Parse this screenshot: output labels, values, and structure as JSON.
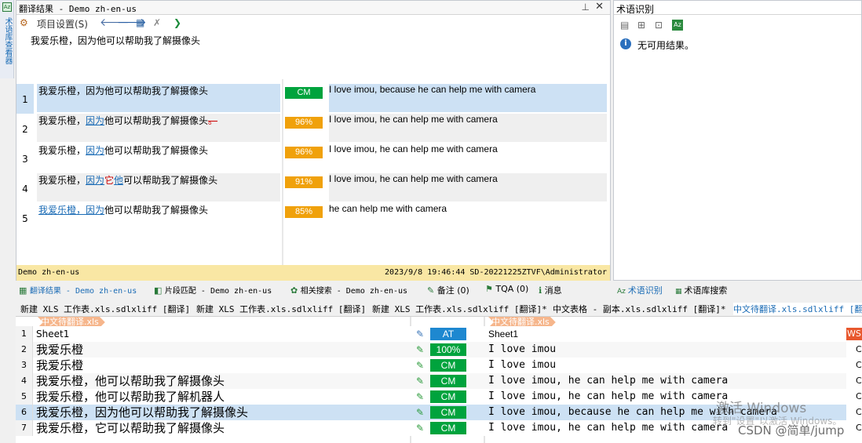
{
  "left_vertical_tab": {
    "label": "术语库查看器"
  },
  "translation_results": {
    "title": "翻译结果 - Demo zh-en-us",
    "toolbar": {
      "project_settings": "项目设置(S)"
    },
    "source_text": "我爱乐橙，因为他可以帮助我了解摄像头",
    "rows": [
      {
        "num": "1",
        "source": [
          {
            "t": "我爱乐橙，因为他可以帮助我了解摄像头",
            "s": ""
          }
        ],
        "badge": "CM",
        "badge_color": "#00a33d",
        "target": "I love imou, because he can help me with camera",
        "selected": true
      },
      {
        "num": "2",
        "source": [
          {
            "t": "我爱乐橙，",
            "s": ""
          },
          {
            "t": "因为",
            "s": "u"
          },
          {
            "t": "他可以帮助我了解摄像头",
            "s": ""
          },
          {
            "t": "。",
            "s": "x"
          }
        ],
        "badge": "96%",
        "badge_color": "#f0a10b",
        "target": "I love imou, he can help me with camera",
        "selected": false
      },
      {
        "num": "3",
        "source": [
          {
            "t": "我爱乐橙，",
            "s": ""
          },
          {
            "t": "因为",
            "s": "u"
          },
          {
            "t": "他可以帮助我了解摄像头",
            "s": ""
          }
        ],
        "badge": "96%",
        "badge_color": "#f0a10b",
        "target": "I love imou, he can help me with camera",
        "selected": false
      },
      {
        "num": "4",
        "source": [
          {
            "t": "我爱乐橙，",
            "s": ""
          },
          {
            "t": "因为",
            "s": "u"
          },
          {
            "t": "它",
            "s": "r"
          },
          {
            "t": "他",
            "s": "u"
          },
          {
            "t": "可以帮助我了解摄像头",
            "s": ""
          }
        ],
        "badge": "91%",
        "badge_color": "#f0a10b",
        "target": "I love imou, he can help me with camera",
        "selected": false
      },
      {
        "num": "5",
        "source": [
          {
            "t": "我爱乐橙，因为",
            "s": "u"
          },
          {
            "t": "他可以帮助我了解摄像头",
            "s": ""
          }
        ],
        "badge": "85%",
        "badge_color": "#f0a10b",
        "target": "he can help me with camera",
        "selected": false
      }
    ],
    "status": {
      "left": "Demo zh-en-us",
      "right": "2023/9/8 19:46:44 SD-20221225ZTVF\\Administrator"
    }
  },
  "term_recognition": {
    "title": "术语识别",
    "message": "无可用结果。"
  },
  "bottom_tabs": [
    {
      "label": "翻译结果 - Demo zh-en-us",
      "active": true
    },
    {
      "label": "片段匹配 - Demo zh-en-us",
      "active": false
    },
    {
      "label": "相关搜索 - Demo zh-en-us",
      "active": false
    },
    {
      "label": "备注 (0)",
      "active": false
    },
    {
      "label": "TQA (0)",
      "active": false
    },
    {
      "label": "消息",
      "active": false
    }
  ],
  "right_bottom_tabs": [
    {
      "label": "术语识别",
      "active": true
    },
    {
      "label": "术语库搜索",
      "active": false
    }
  ],
  "doc_tabs": [
    {
      "label": "新建 XLS 工作表.xls.sdlxliff [翻译]"
    },
    {
      "label": "新建 XLS 工作表.xls.sdlxliff [翻译]"
    },
    {
      "label": "新建 XLS 工作表.xls.sdlxliff [翻译]*"
    },
    {
      "label": "中文表格 - 副本.xls.sdlxliff [翻译]*"
    },
    {
      "label": "中文待翻译.xls.sdlxliff [翻"
    }
  ],
  "editor": {
    "file_tag_src": "中文待翻译.xls",
    "file_tag_tgt": "中文待翻译.xls",
    "ws_tag": "WS",
    "rows": [
      {
        "num": "1",
        "source": "Sheet1",
        "badge": "AT",
        "badge_color": "#1e88d0",
        "target": "Sheet1",
        "extra": ""
      },
      {
        "num": "2",
        "source": "我爱乐橙",
        "badge": "100%",
        "badge_color": "#00a33d",
        "target": "I love imou",
        "extra": "C"
      },
      {
        "num": "3",
        "source": "我爱乐橙",
        "badge": "CM",
        "badge_color": "#00a33d",
        "target": "I love imou",
        "extra": "C"
      },
      {
        "num": "4",
        "source": "我爱乐橙，他可以帮助我了解摄像头",
        "badge": "CM",
        "badge_color": "#00a33d",
        "target": "I love imou, he can help me with camera",
        "extra": "C"
      },
      {
        "num": "5",
        "source": "我爱乐橙，他可以帮助我了解机器人",
        "badge": "CM",
        "badge_color": "#00a33d",
        "target": "I love imou, he can help me with camera",
        "extra": "C"
      },
      {
        "num": "6",
        "source": "我爱乐橙，因为他可以帮助我了解摄像头",
        "badge": "CM",
        "badge_color": "#00a33d",
        "target": "I love imou, because he can help me with camera",
        "extra": "C"
      },
      {
        "num": "7",
        "source": "我爱乐橙，它可以帮助我了解摄像头",
        "badge": "CM",
        "badge_color": "#00a33d",
        "target": "I love imou, he can help me with camera",
        "extra": "C"
      }
    ]
  },
  "watermark": {
    "activate": "激活 Windows",
    "activate_sub": "转到\"设置\"以激活 Windows。",
    "csdn": "CSDN @简单/jump"
  }
}
